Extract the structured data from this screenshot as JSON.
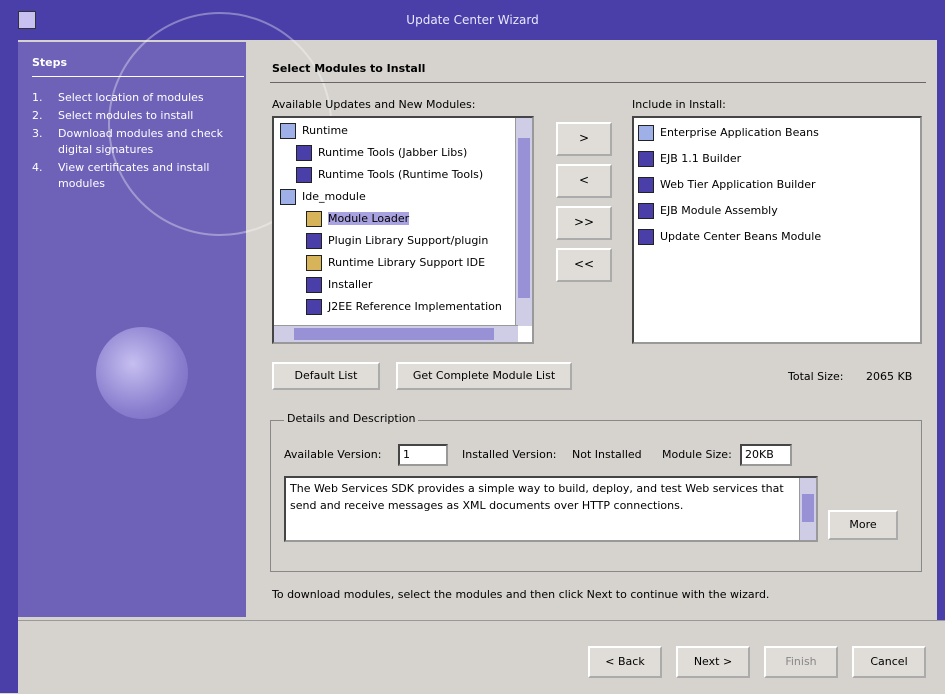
{
  "window": {
    "title": "Update Center Wizard"
  },
  "sidebar": {
    "title": "Steps",
    "steps": [
      {
        "num": "1.",
        "label": "Select location of modules"
      },
      {
        "num": "2.",
        "label": "Select modules to install"
      },
      {
        "num": "3.",
        "label": "Download modules and check digital signatures"
      },
      {
        "num": "4.",
        "label": "View certificates and install modules"
      }
    ]
  },
  "main": {
    "title": "Select Modules to Install",
    "available_label": "Available Updates and New Modules:",
    "include_label": "Include in Install:",
    "tree": [
      {
        "label": "Runtime",
        "indent": 0,
        "icon": "folder-icon"
      },
      {
        "label": "Runtime Tools (Jabber Libs)",
        "indent": 1,
        "icon": "module-icon"
      },
      {
        "label": "Runtime Tools (Runtime Tools)",
        "indent": 1,
        "icon": "module-icon"
      },
      {
        "label": "Ide_module",
        "indent": 0,
        "icon": "folder-icon"
      },
      {
        "label": "Module Loader",
        "indent": 1,
        "icon": "module-icon",
        "selected": true
      },
      {
        "label": "Plugin Library Support/plugin",
        "indent": 1,
        "icon": "module-icon"
      },
      {
        "label": "Runtime Library Support IDE",
        "indent": 1,
        "icon": "module-icon"
      },
      {
        "label": "Installer",
        "indent": 1,
        "icon": "module-icon"
      },
      {
        "label": "J2EE Reference Implementation",
        "indent": 1,
        "icon": "module-icon"
      }
    ],
    "arrows": [
      ">",
      "<",
      ">>",
      "<<"
    ],
    "include_items": [
      "Enterprise Application Beans",
      "EJB 1.1 Builder",
      "Web Tier Application Builder",
      "EJB Module Assembly",
      "Update Center Beans Module"
    ],
    "default_button": "Default List",
    "global_button": "Get Complete Module List",
    "total_size_label": "Total Size:",
    "total_size_value": "2065 KB",
    "details": {
      "legend": "Details and Description",
      "available_version_label": "Available Version:",
      "available_version_value": "1",
      "installed_version_label": "Installed Version:",
      "installed_version_value": "Not Installed",
      "module_size_label": "Module Size:",
      "module_size_value": "20KB",
      "description": "The Web Services SDK provides a simple way to build, deploy, and test Web services that send and receive messages as XML documents over HTTP connections.",
      "more_button": "More"
    },
    "status_text": "To download modules, select the modules and then click Next to continue with the wizard."
  },
  "footer": {
    "back_button": "< Back",
    "next_button": "Next >",
    "finish_button": "Finish",
    "cancel_button": "Cancel"
  },
  "colors": {
    "titlebar": "#4a3fa8",
    "sidebar": "#6e62b8",
    "background": "#d6d3ce",
    "selection": "#a9a2e0"
  }
}
